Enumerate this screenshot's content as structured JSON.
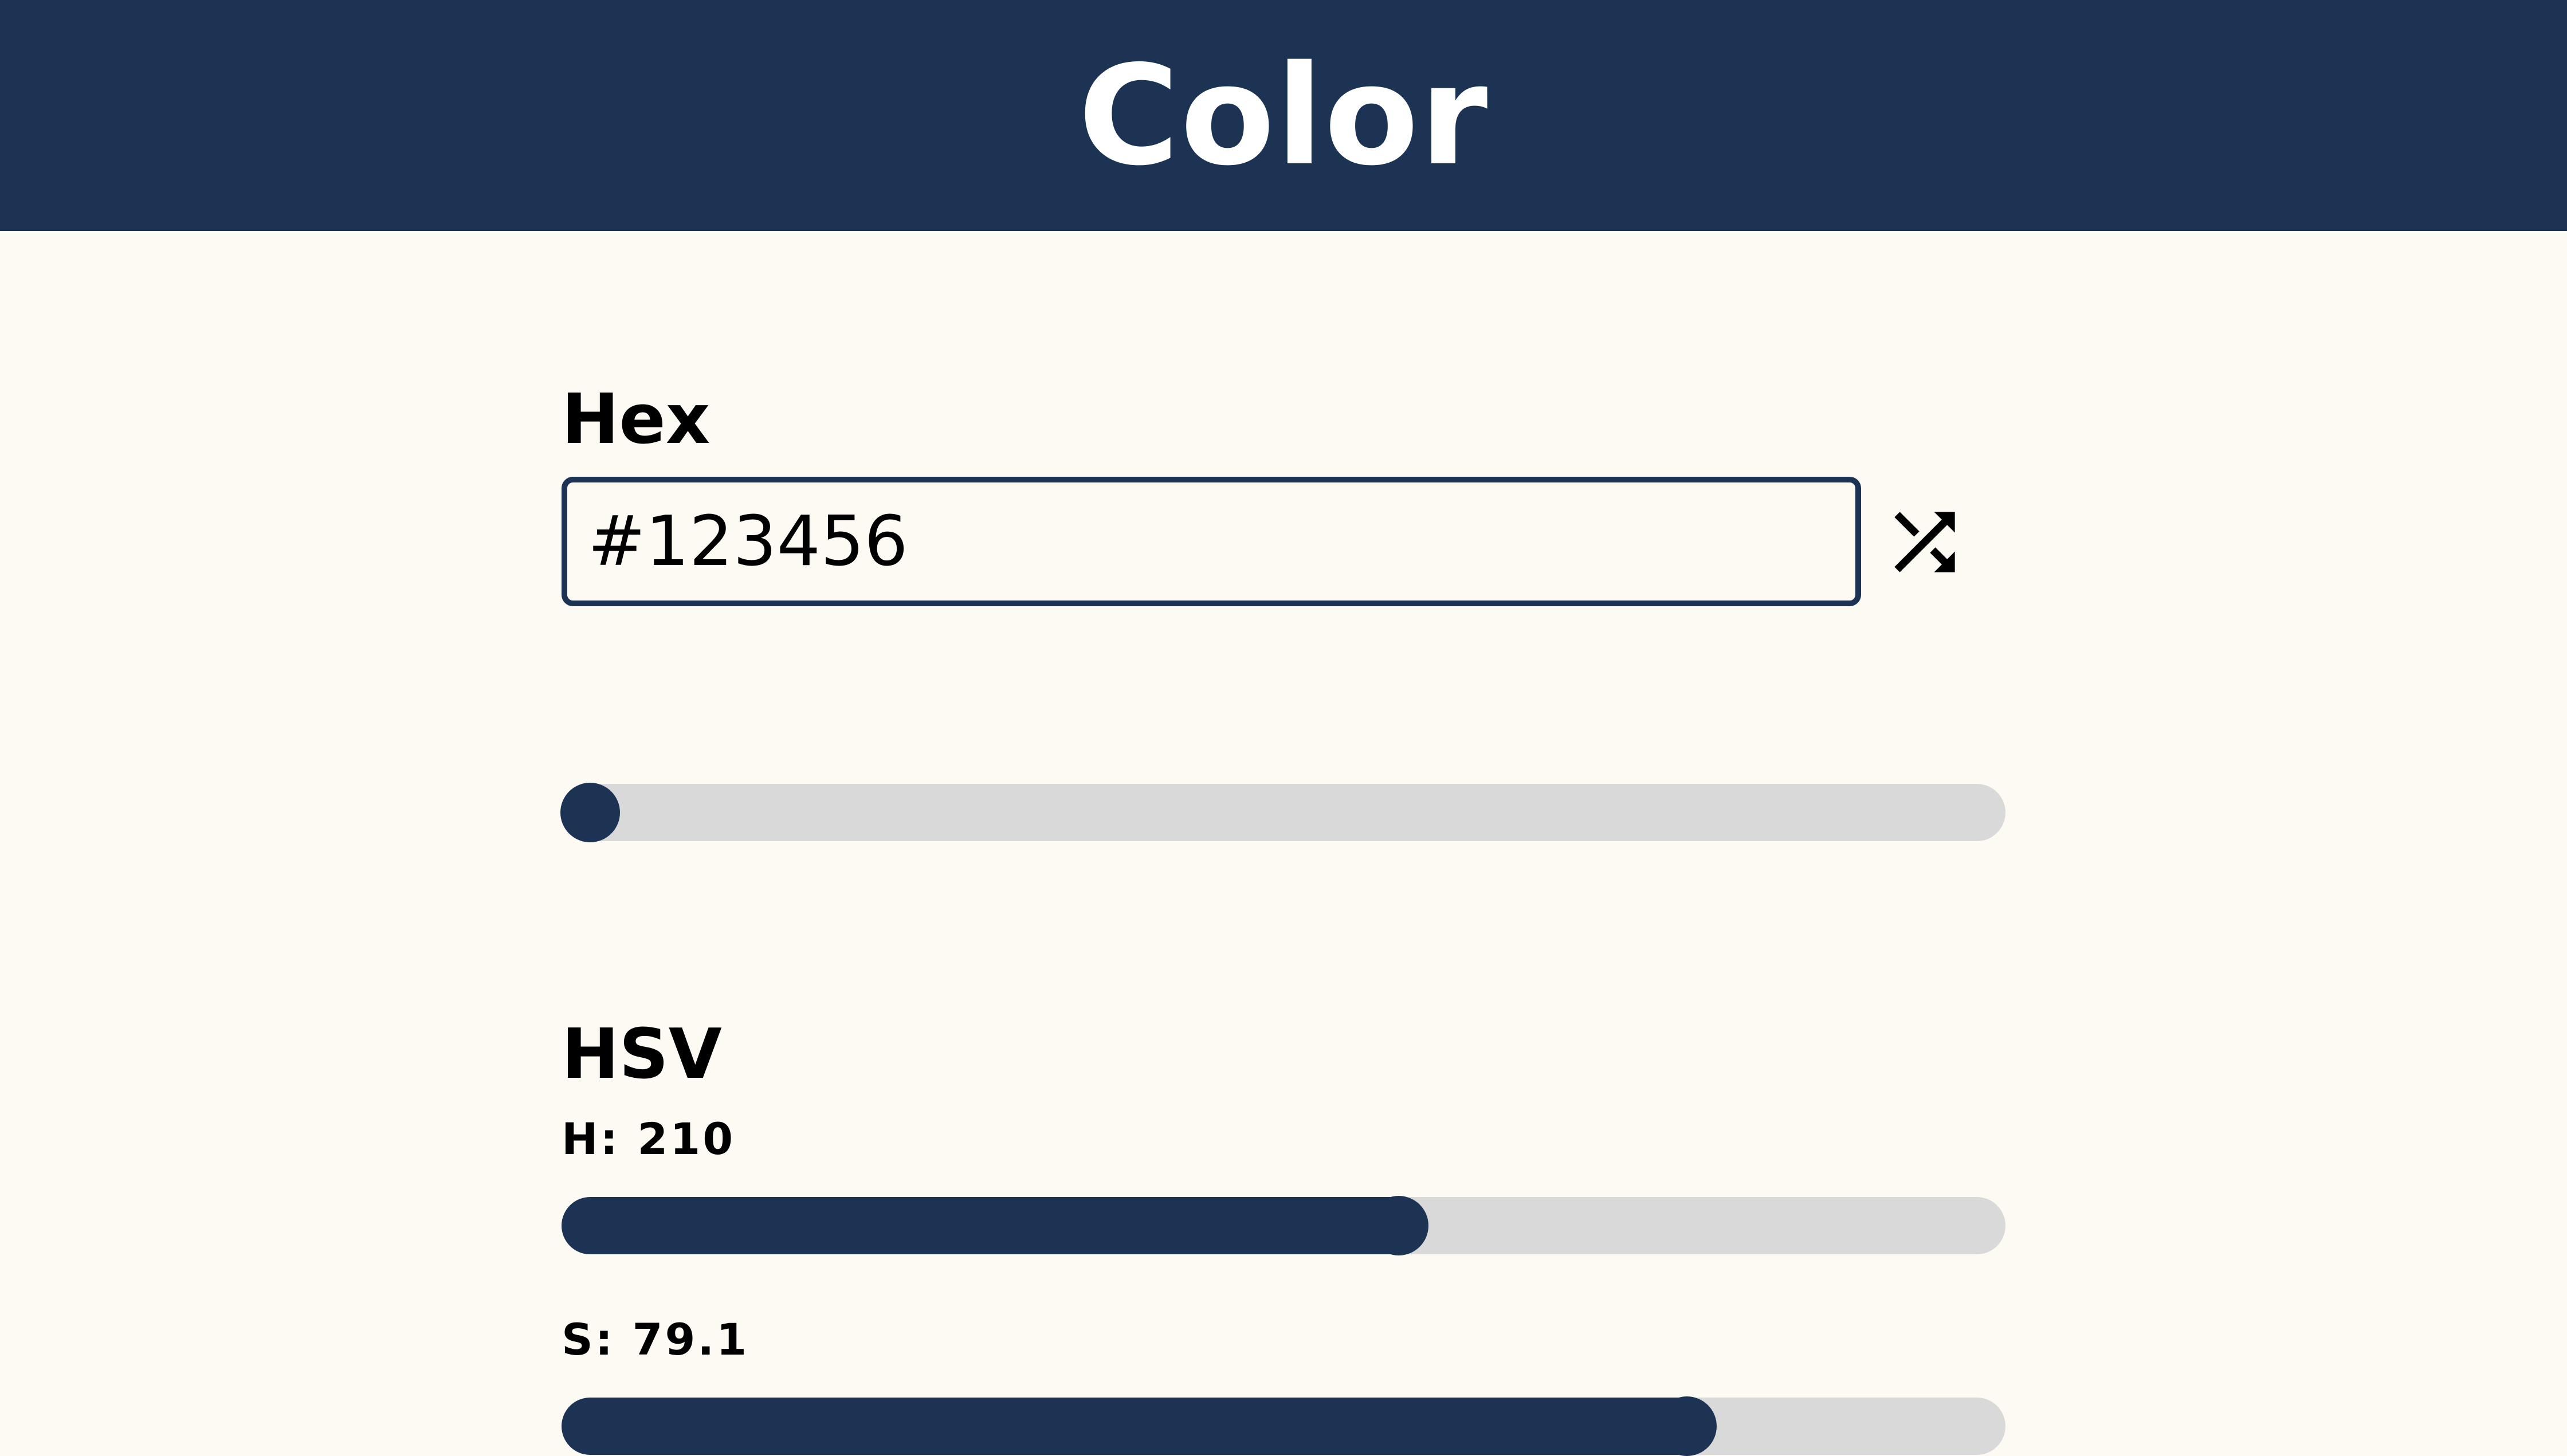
{
  "header": {
    "title": "Color"
  },
  "hex": {
    "title": "Hex",
    "value": "#123456"
  },
  "alpha_slider": {
    "value": 0.0
  },
  "hsv": {
    "title": "HSV",
    "h": {
      "label": "H: 210",
      "value": 0.583
    },
    "s": {
      "label": "S: 79.1",
      "value": 0.791
    }
  },
  "icons": {
    "shuffle": "shuffle-icon"
  },
  "colors": {
    "accent": "#1c3353",
    "background": "#fdfaf4",
    "track": "#d9d9d9"
  }
}
